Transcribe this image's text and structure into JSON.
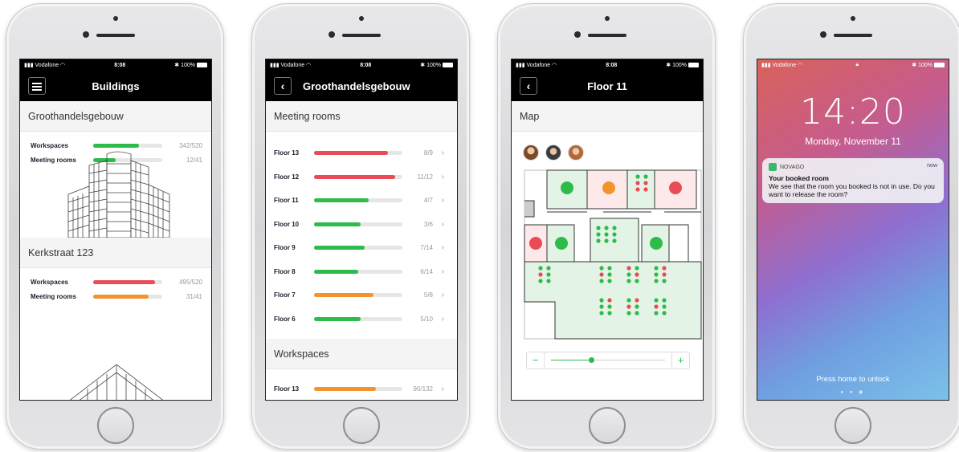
{
  "colors": {
    "green": "#2dbb4a",
    "red": "#e94b57",
    "orange": "#f4922e",
    "track": "#e6e6e6",
    "header_bg": "#000000"
  },
  "status": {
    "carrier": "Vodafone",
    "time": "8:08",
    "battery": "100%"
  },
  "screen1": {
    "title": "Buildings",
    "menu_icon": "hamburger-icon",
    "buildings": [
      {
        "name": "Groothandelsgebouw",
        "stats": [
          {
            "label": "Workspaces",
            "count": "342/520",
            "fill": 0.66,
            "color": "green"
          },
          {
            "label": "Meeting rooms",
            "count": "12/41",
            "fill": 0.33,
            "color": "green"
          }
        ]
      },
      {
        "name": "Kerkstraat 123",
        "stats": [
          {
            "label": "Workspaces",
            "count": "495/520",
            "fill": 0.9,
            "color": "red"
          },
          {
            "label": "Meeting rooms",
            "count": "31/41",
            "fill": 0.8,
            "color": "orange"
          }
        ]
      }
    ]
  },
  "screen2": {
    "title": "Groothandelsgebouw",
    "back_icon": "back-chevron-icon",
    "meeting_rooms_heading": "Meeting rooms",
    "floors": [
      {
        "label": "Floor 13",
        "count": "8/9",
        "fill": 0.84,
        "color": "red"
      },
      {
        "label": "Floor 12",
        "count": "11/12",
        "fill": 0.92,
        "color": "red"
      },
      {
        "label": "Floor 11",
        "count": "4/7",
        "fill": 0.62,
        "color": "green"
      },
      {
        "label": "Floor 10",
        "count": "3/6",
        "fill": 0.53,
        "color": "green"
      },
      {
        "label": "Floor 9",
        "count": "7/14",
        "fill": 0.57,
        "color": "green"
      },
      {
        "label": "Floor 8",
        "count": "6/14",
        "fill": 0.5,
        "color": "green"
      },
      {
        "label": "Floor 7",
        "count": "5/8",
        "fill": 0.67,
        "color": "orange"
      },
      {
        "label": "Floor 6",
        "count": "5/10",
        "fill": 0.53,
        "color": "green"
      }
    ],
    "workspaces_heading": "Workspaces",
    "workspace_floors": [
      {
        "label": "Floor 13",
        "count": "90/132",
        "fill": 0.7,
        "color": "orange"
      }
    ]
  },
  "screen3": {
    "title": "Floor 11",
    "back_icon": "back-chevron-icon",
    "map_heading": "Map",
    "zoom_minus": "−",
    "zoom_plus": "+",
    "zoom_level": 0.35
  },
  "screen4": {
    "time": "14:20",
    "date": "Monday, November 11",
    "notification": {
      "app": "NOVAGO",
      "when": "now",
      "title": "Your booked room",
      "body": "We see that the room you booked is not in use. Do you want to release the room?"
    },
    "unlock_hint": "Press home to unlock"
  }
}
